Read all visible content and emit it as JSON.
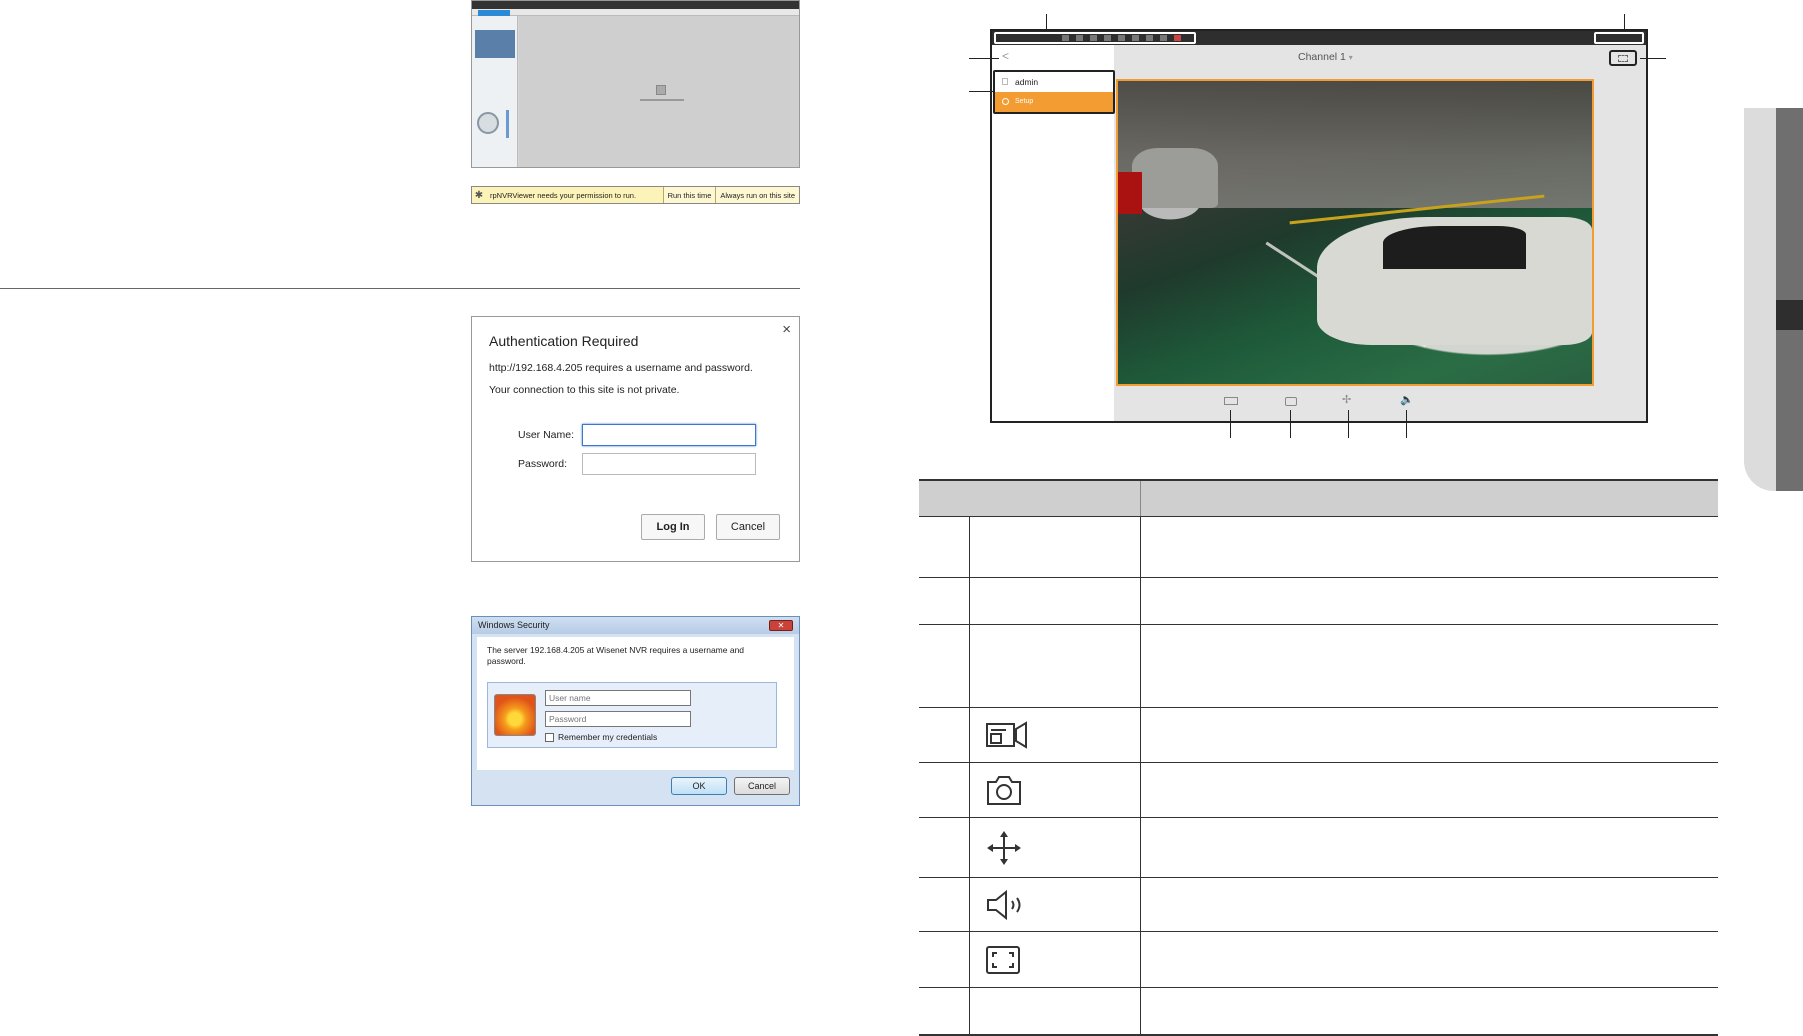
{
  "plugin_bar": {
    "message": "rpNVRViewer needs your permission to run.",
    "run_once": "Run this time",
    "always_run": "Always run on this site"
  },
  "auth_dialog": {
    "title": "Authentication Required",
    "line1": "http://192.168.4.205 requires a username and password.",
    "line2": "Your connection to this site is not private.",
    "username_label": "User Name:",
    "password_label": "Password:",
    "login_button": "Log In",
    "cancel_button": "Cancel",
    "close": "×"
  },
  "windows_security": {
    "title": "Windows Security",
    "message": "The server 192.168.4.205 at Wisenet NVR requires a username and password.",
    "username_placeholder": "User name",
    "password_placeholder": "Password",
    "remember": "Remember my credentials",
    "ok_button": "OK",
    "cancel_button": "Cancel"
  },
  "viewer": {
    "back": "<",
    "user": "admin",
    "setup": "Setup",
    "channel": "Channel 1",
    "channel_caret": "▾",
    "toolbar": {
      "ptz": "✢",
      "audio": "🔈"
    }
  },
  "colors": {
    "accent": "#f39c32",
    "table_header": "#cfcfcf"
  }
}
